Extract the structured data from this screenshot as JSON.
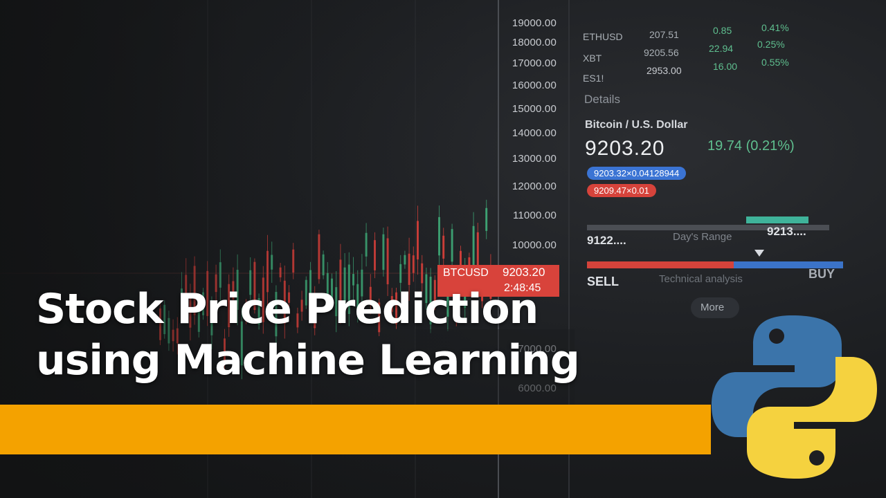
{
  "title": {
    "line1": "Stock Price Prediction",
    "line2": "using Machine Learning"
  },
  "colors": {
    "accent_bar": "#f4a200",
    "python_blue": "#3b74aa",
    "python_yellow": "#f5d23f",
    "candle_red": "#e2423c",
    "candle_green": "#3fae7a"
  },
  "logo": {
    "icon": "python-logo-icon"
  },
  "background": {
    "axis_labels": [
      "19000.00",
      "18000.00",
      "17000.00",
      "16000.00",
      "15000.00",
      "14000.00",
      "13000.00",
      "12000.00",
      "11000.00",
      "10000.00",
      "7000.00",
      "6000.00"
    ],
    "price_tag": {
      "symbol": "BTCUSD",
      "price": "9203.20",
      "timer": "2:48:45"
    },
    "tickers": [
      {
        "name": "ETHUSD",
        "price": "207.51",
        "change": "0.85",
        "pct": "0.41%"
      },
      {
        "name": "XBT",
        "price": "9205.56",
        "change": "22.94",
        "pct": "0.25%"
      },
      {
        "name": "ES1!",
        "price": "2953.00",
        "change": "16.00",
        "pct": "0.55%"
      }
    ],
    "details": {
      "heading": "Details",
      "pair": "Bitcoin / U.S. Dollar",
      "price": "9203.20",
      "change": "19.74 (0.21%)",
      "bid": "9203.32×0.04128944",
      "ask": "9209.47×0.01",
      "range_low": "9122....",
      "range_label": "Day's Range",
      "range_high": "9213....",
      "sell": "SELL",
      "tech_label": "Technical analysis",
      "buy": "BUY",
      "more": "More"
    }
  }
}
